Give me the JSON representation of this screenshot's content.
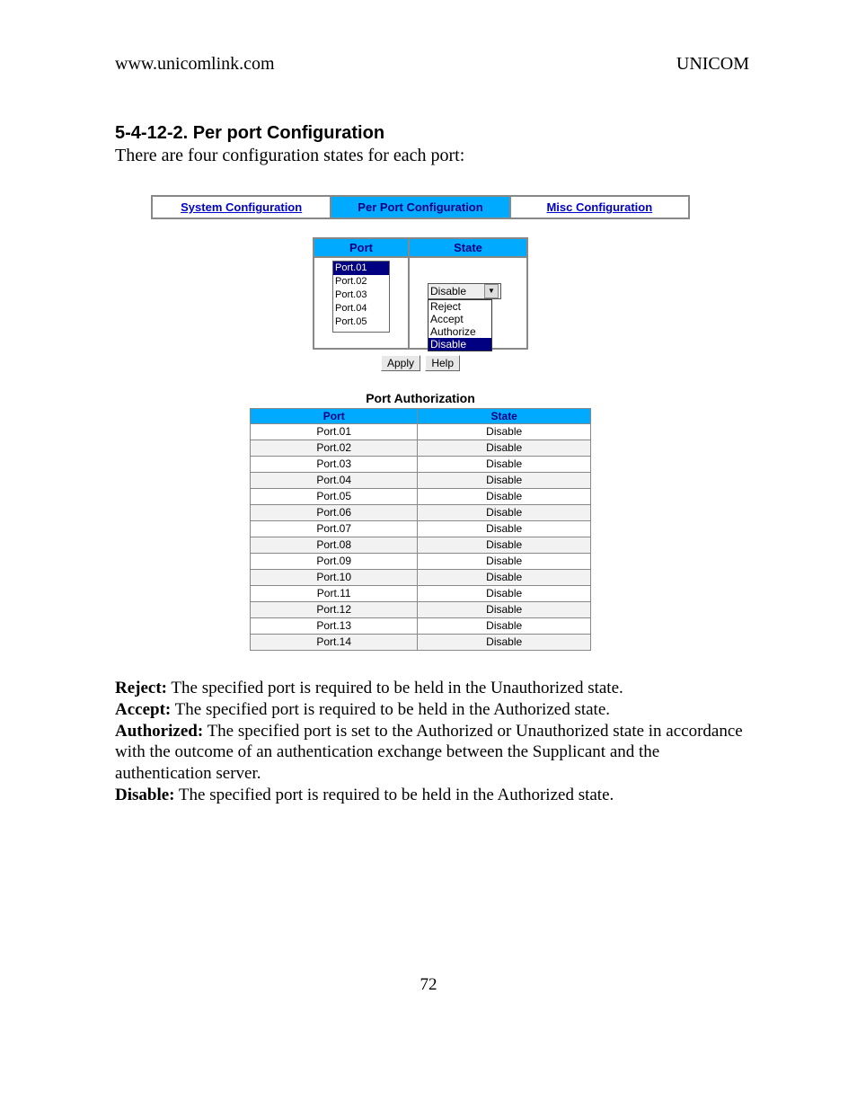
{
  "header": {
    "left": "www.unicomlink.com",
    "right": "UNICOM"
  },
  "section": {
    "title": "5-4-12-2. Per port Configuration",
    "intro": "There are four configuration states for each port:"
  },
  "nav": {
    "items": [
      {
        "label": "System Configuration",
        "active": false
      },
      {
        "label": "Per Port Configuration",
        "active": true
      },
      {
        "label": "Misc Configuration",
        "active": false
      }
    ]
  },
  "config_table": {
    "port_header": "Port",
    "state_header": "State",
    "port_options": [
      "Port.01",
      "Port.02",
      "Port.03",
      "Port.04",
      "Port.05"
    ],
    "port_selected": "Port.01",
    "state_selected": "Disable",
    "state_options": [
      "Reject",
      "Accept",
      "Authorize",
      "Disable"
    ],
    "state_highlight": "Disable"
  },
  "buttons": {
    "apply": "Apply",
    "help": "Help"
  },
  "port_auth": {
    "title": "Port Authorization",
    "columns": [
      "Port",
      "State"
    ],
    "rows": [
      {
        "port": "Port.01",
        "state": "Disable"
      },
      {
        "port": "Port.02",
        "state": "Disable"
      },
      {
        "port": "Port.03",
        "state": "Disable"
      },
      {
        "port": "Port.04",
        "state": "Disable"
      },
      {
        "port": "Port.05",
        "state": "Disable"
      },
      {
        "port": "Port.06",
        "state": "Disable"
      },
      {
        "port": "Port.07",
        "state": "Disable"
      },
      {
        "port": "Port.08",
        "state": "Disable"
      },
      {
        "port": "Port.09",
        "state": "Disable"
      },
      {
        "port": "Port.10",
        "state": "Disable"
      },
      {
        "port": "Port.11",
        "state": "Disable"
      },
      {
        "port": "Port.12",
        "state": "Disable"
      },
      {
        "port": "Port.13",
        "state": "Disable"
      },
      {
        "port": "Port.14",
        "state": "Disable"
      }
    ]
  },
  "definitions": {
    "reject_label": "Reject:",
    "reject_text": " The specified port is required to be held in the Unauthorized state.",
    "accept_label": "Accept:",
    "accept_text": " The specified port is required to be held in the Authorized state.",
    "authorized_label": "Authorized:",
    "authorized_text": " The specified port is set to the Authorized or Unauthorized state in accordance with the outcome of an authentication exchange between the Supplicant and the authentication server.",
    "disable_label": "Disable:",
    "disable_text": " The specified port is required to be held in the Authorized state."
  },
  "page_number": "72"
}
